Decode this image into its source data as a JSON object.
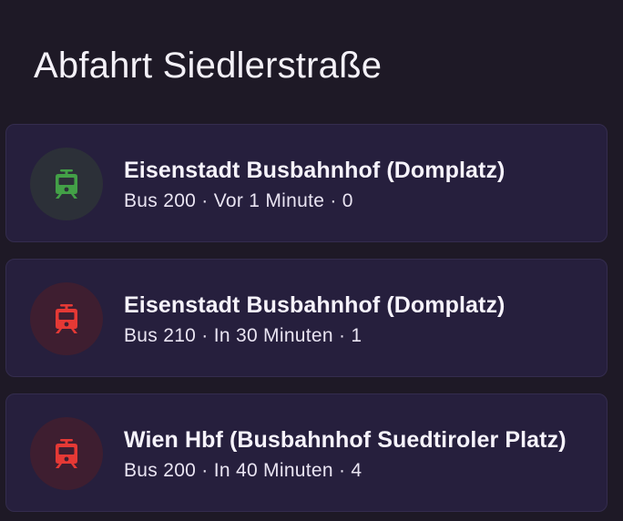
{
  "header": {
    "title": "Abfahrt Siedlerstraße"
  },
  "colors": {
    "page_background": "#1e1926",
    "card_background": "#261f3d",
    "status_ok": "#43a047",
    "status_ok_bg": "#2c3038",
    "status_late": "#e53935",
    "status_late_bg": "#3e1e30"
  },
  "departures": [
    {
      "icon": "tram-icon",
      "status": "ok",
      "destination": "Eisenstadt Busbahnhof (Domplatz)",
      "detail": "Bus 200 · Vor 1 Minute · 0"
    },
    {
      "icon": "tram-icon",
      "status": "late",
      "destination": "Eisenstadt Busbahnhof (Domplatz)",
      "detail": "Bus 210 · In 30 Minuten · 1"
    },
    {
      "icon": "tram-icon",
      "status": "late",
      "destination": "Wien Hbf (Busbahnhof Suedtiroler Platz)",
      "detail": "Bus 200 · In 40 Minuten · 4"
    }
  ]
}
